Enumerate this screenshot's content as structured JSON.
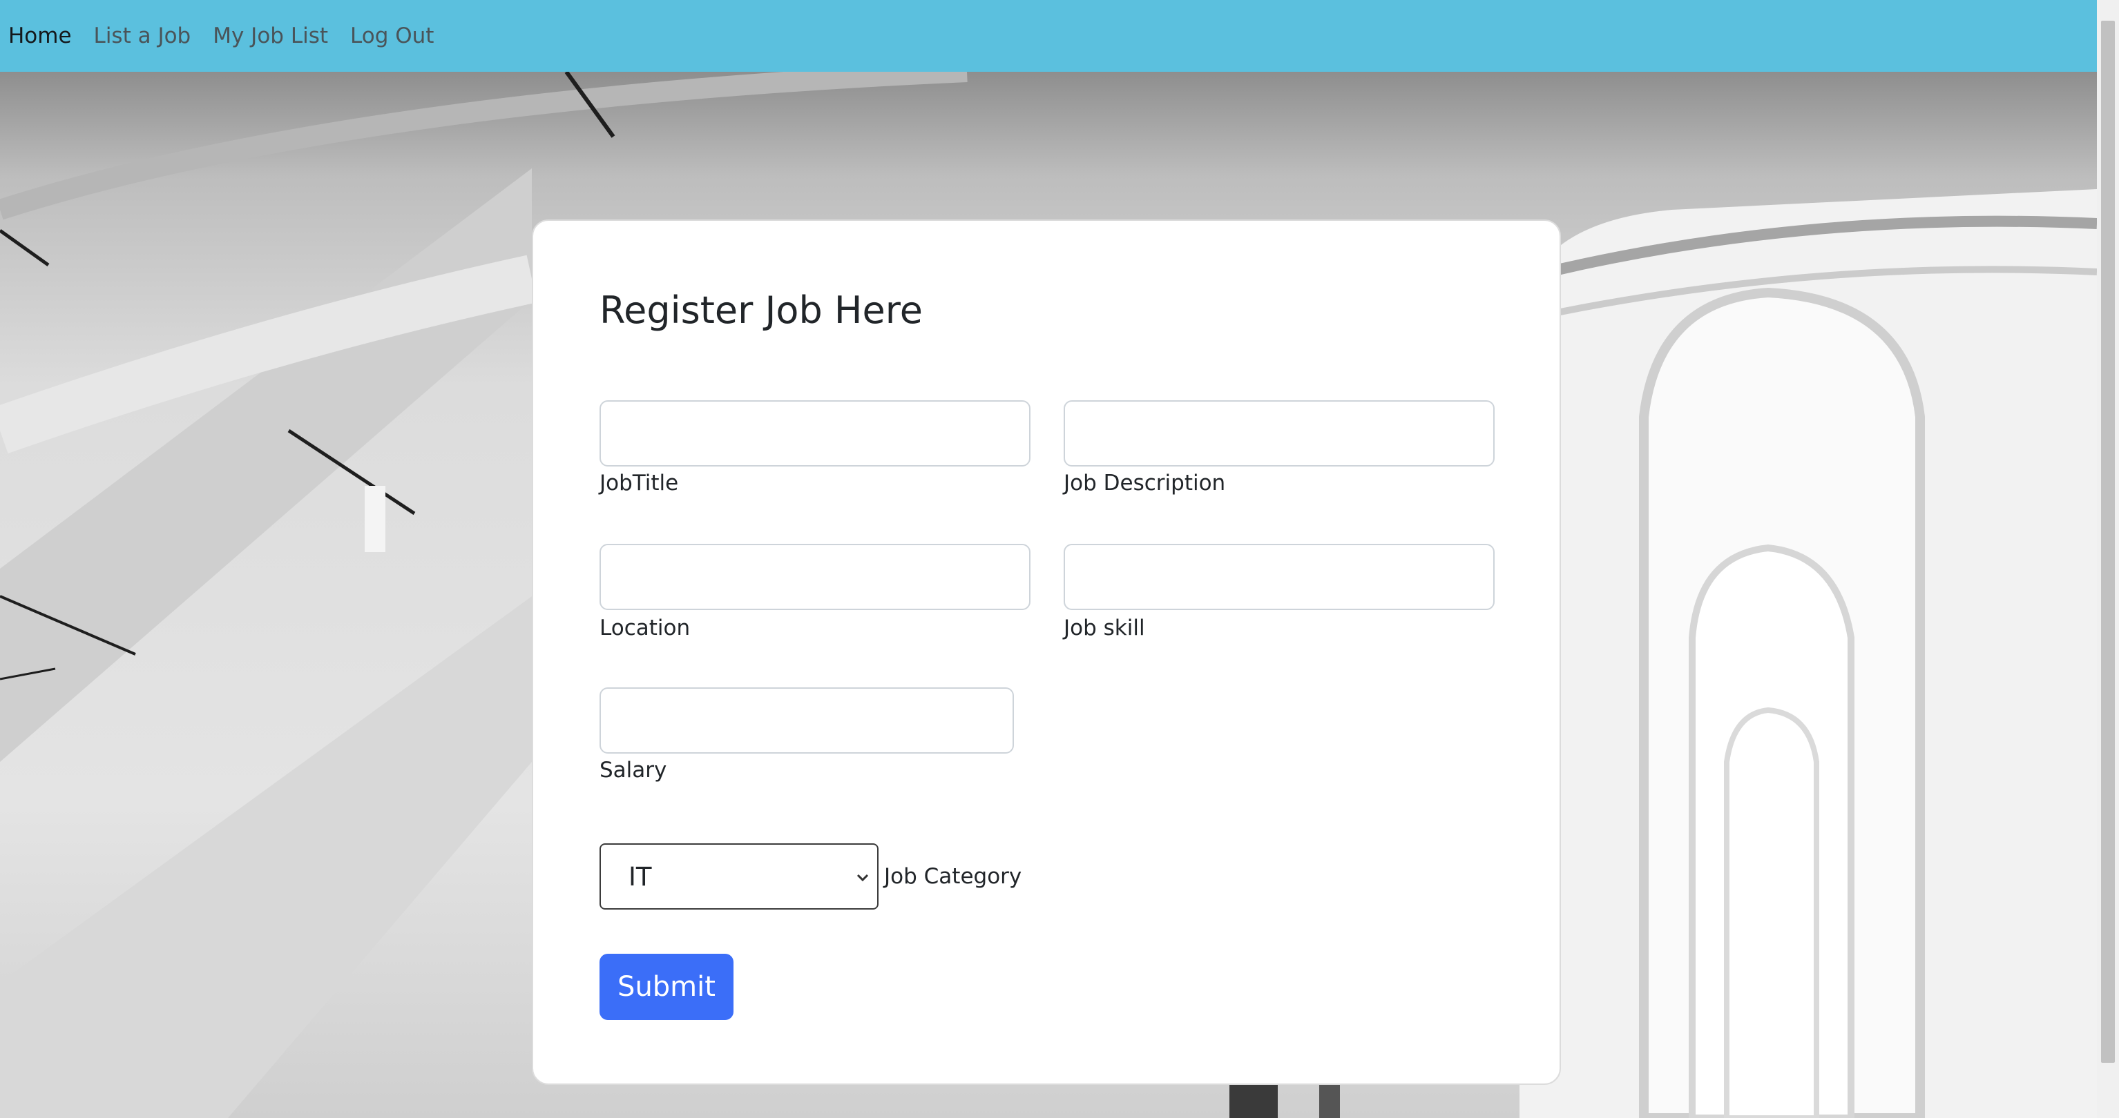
{
  "nav": {
    "items": [
      {
        "label": "Home",
        "active": true
      },
      {
        "label": "List a Job",
        "active": false
      },
      {
        "label": "My Job List",
        "active": false
      },
      {
        "label": "Log Out",
        "active": false
      }
    ]
  },
  "form": {
    "title": "Register Job Here",
    "fields": {
      "job_title": {
        "label": "JobTitle",
        "value": ""
      },
      "job_description": {
        "label": "Job Description",
        "value": ""
      },
      "location": {
        "label": "Location",
        "value": ""
      },
      "job_skill": {
        "label": "Job skill",
        "value": ""
      },
      "salary": {
        "label": "Salary",
        "value": ""
      }
    },
    "category": {
      "label": "Job Category",
      "selected": "IT"
    },
    "submit_label": "Submit"
  },
  "colors": {
    "navbar": "#5bc0de",
    "primary_button": "#3b6ef8"
  }
}
